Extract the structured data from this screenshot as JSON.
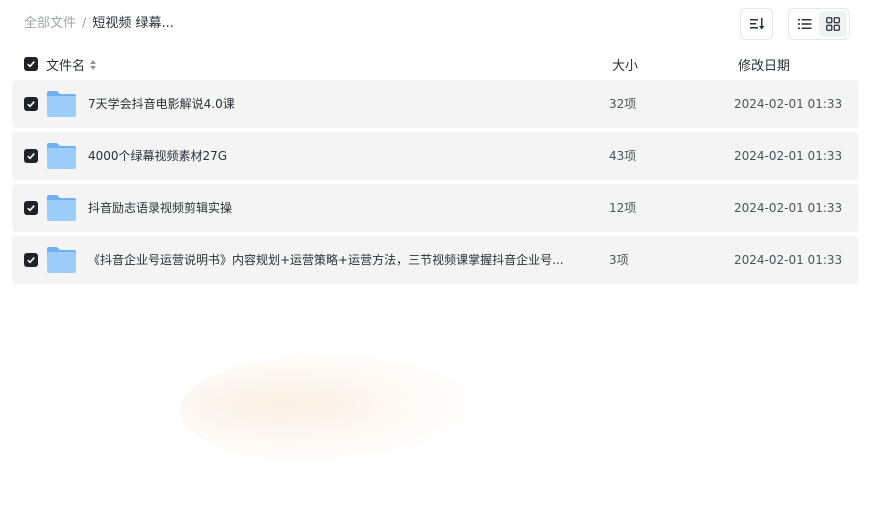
{
  "breadcrumb": {
    "root": "全部文件",
    "separator": "/",
    "current": "短视频 绿幕..."
  },
  "toolbar": {
    "sort_icon": "sort-icon",
    "list_view_icon": "list-view-icon",
    "grid_view_icon": "grid-view-icon",
    "active_view": "list"
  },
  "table": {
    "columns": {
      "name": "文件名",
      "size": "大小",
      "date": "修改日期"
    },
    "header_checked": true,
    "rows": [
      {
        "name": "7天学会抖音电影解说4.0课",
        "size": "32项",
        "date": "2024-02-01 01:33",
        "checked": true,
        "icon": "folder-icon"
      },
      {
        "name": "4000个绿幕视频素材27G",
        "size": "43项",
        "date": "2024-02-01 01:33",
        "checked": true,
        "icon": "folder-icon"
      },
      {
        "name": "抖音励志语录视频剪辑实操",
        "size": "12项",
        "date": "2024-02-01 01:33",
        "checked": true,
        "icon": "folder-icon"
      },
      {
        "name": "《抖音企业号运营说明书》内容规划+运营策略+运营方法，三节视频课掌握抖音企业号...",
        "size": "3项",
        "date": "2024-02-01 01:33",
        "checked": true,
        "icon": "folder-icon"
      }
    ]
  },
  "colors": {
    "row_background": "#f4f4f5",
    "checkbox": "#1f2329",
    "folder": "#8cc4f6"
  }
}
